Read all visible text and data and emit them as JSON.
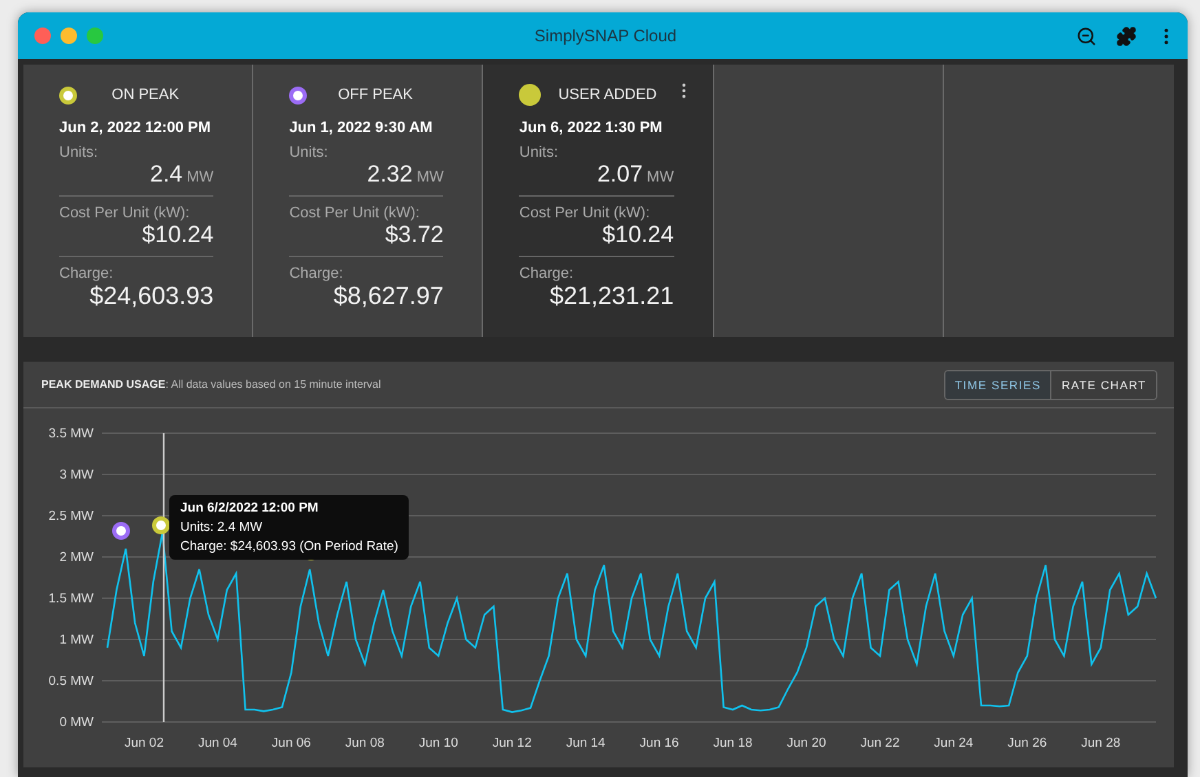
{
  "window": {
    "title": "SimplySNAP Cloud"
  },
  "cards": [
    {
      "label": "ON PEAK",
      "kind": "ring",
      "color": "#c9c93a",
      "selected": false,
      "date": "Jun 2, 2022 12:00 PM",
      "units_label": "Units:",
      "units": "2.4",
      "unit": "MW",
      "cost_label": "Cost Per Unit (kW):",
      "cost": "$10.24",
      "charge_label": "Charge:",
      "charge": "$24,603.93"
    },
    {
      "label": "OFF PEAK",
      "kind": "ring",
      "color": "#9b6cf5",
      "selected": false,
      "date": "Jun 1, 2022 9:30 AM",
      "units_label": "Units:",
      "units": "2.32",
      "unit": "MW",
      "cost_label": "Cost Per Unit (kW):",
      "cost": "$3.72",
      "charge_label": "Charge:",
      "charge": "$8,627.97"
    },
    {
      "label": "USER ADDED",
      "kind": "solid",
      "color": "#c9c93a",
      "selected": true,
      "date": "Jun 6, 2022 1:30 PM",
      "units_label": "Units:",
      "units": "2.07",
      "unit": "MW",
      "cost_label": "Cost Per Unit (kW):",
      "cost": "$10.24",
      "charge_label": "Charge:",
      "charge": "$21,231.21"
    }
  ],
  "chart": {
    "title": "**PEAK DEMAND USAGE**: All data values based on 15 minute interval",
    "toggles": [
      {
        "label": "TIME SERIES",
        "selected": true
      },
      {
        "label": "RATE CHART",
        "selected": false
      }
    ],
    "chart_data": {
      "type": "line",
      "grid": true,
      "ylim": [
        0,
        3.5
      ],
      "yticks": [
        {
          "value": 3.5,
          "label": "3.5 MW"
        },
        {
          "value": 3,
          "label": "3 MW"
        },
        {
          "value": 2.5,
          "label": "2.5 MW"
        },
        {
          "value": 2,
          "label": "2 MW"
        },
        {
          "value": 1.5,
          "label": "1.5 MW"
        },
        {
          "value": 1,
          "label": "1 MW"
        },
        {
          "value": 0.5,
          "label": "0.5 MW"
        },
        {
          "value": 0,
          "label": "0 MW"
        }
      ],
      "categories": [
        null,
        null,
        null,
        null,
        "Jun 02",
        null,
        null,
        null,
        null,
        null,
        null,
        null,
        "Jun 04",
        null,
        null,
        null,
        null,
        null,
        null,
        null,
        "Jun 06",
        null,
        null,
        null,
        null,
        null,
        null,
        null,
        "Jun 08",
        null,
        null,
        null,
        null,
        null,
        null,
        null,
        "Jun 10",
        null,
        null,
        null,
        null,
        null,
        null,
        null,
        "Jun 12",
        null,
        null,
        null,
        null,
        null,
        null,
        null,
        "Jun 14",
        null,
        null,
        null,
        null,
        null,
        null,
        null,
        "Jun 16",
        null,
        null,
        null,
        null,
        null,
        null,
        null,
        "Jun 18",
        null,
        null,
        null,
        null,
        null,
        null,
        null,
        "Jun 20",
        null,
        null,
        null,
        null,
        null,
        null,
        null,
        "Jun 22",
        null,
        null,
        null,
        null,
        null,
        null,
        null,
        "Jun 24",
        null,
        null,
        null,
        null,
        null,
        null,
        null,
        "Jun 26",
        null,
        null,
        null,
        null,
        null,
        null,
        null,
        "Jun 28",
        null,
        null,
        null,
        null,
        null,
        null
      ],
      "series": [
        {
          "color": "#10c2ee",
          "values": [
            0.9,
            1.6,
            2.1,
            1.2,
            0.8,
            1.7,
            2.3,
            1.1,
            0.9,
            1.5,
            1.85,
            1.3,
            1.0,
            1.6,
            1.8,
            0.15,
            0.15,
            0.13,
            0.15,
            0.18,
            0.6,
            1.4,
            1.85,
            1.2,
            0.8,
            1.3,
            1.7,
            1.0,
            0.7,
            1.2,
            1.6,
            1.1,
            0.8,
            1.4,
            1.7,
            0.9,
            0.8,
            1.2,
            1.5,
            1.0,
            0.9,
            1.3,
            1.4,
            0.15,
            0.12,
            0.14,
            0.17,
            0.5,
            0.8,
            1.5,
            1.8,
            1.0,
            0.8,
            1.6,
            1.9,
            1.1,
            0.9,
            1.5,
            1.8,
            1.0,
            0.8,
            1.4,
            1.8,
            1.1,
            0.9,
            1.5,
            1.7,
            0.18,
            0.15,
            0.2,
            0.15,
            0.14,
            0.15,
            0.18,
            0.4,
            0.6,
            0.9,
            1.4,
            1.5,
            1.0,
            0.8,
            1.5,
            1.8,
            0.9,
            0.8,
            1.6,
            1.7,
            1.0,
            0.7,
            1.4,
            1.8,
            1.1,
            0.8,
            1.3,
            1.5,
            0.2,
            0.2,
            0.19,
            0.2,
            0.6,
            0.8,
            1.5,
            1.9,
            1.0,
            0.8,
            1.4,
            1.7,
            0.7,
            0.9,
            1.6,
            1.8,
            1.3,
            1.4,
            1.8,
            1.5
          ]
        }
      ]
    },
    "tooltip": {
      "title": "Jun 6/2/2022 12:00 PM",
      "lines": [
        "Units: 2.4 MW",
        "Charge: $24,603.93 (On Period Rate)"
      ]
    }
  }
}
